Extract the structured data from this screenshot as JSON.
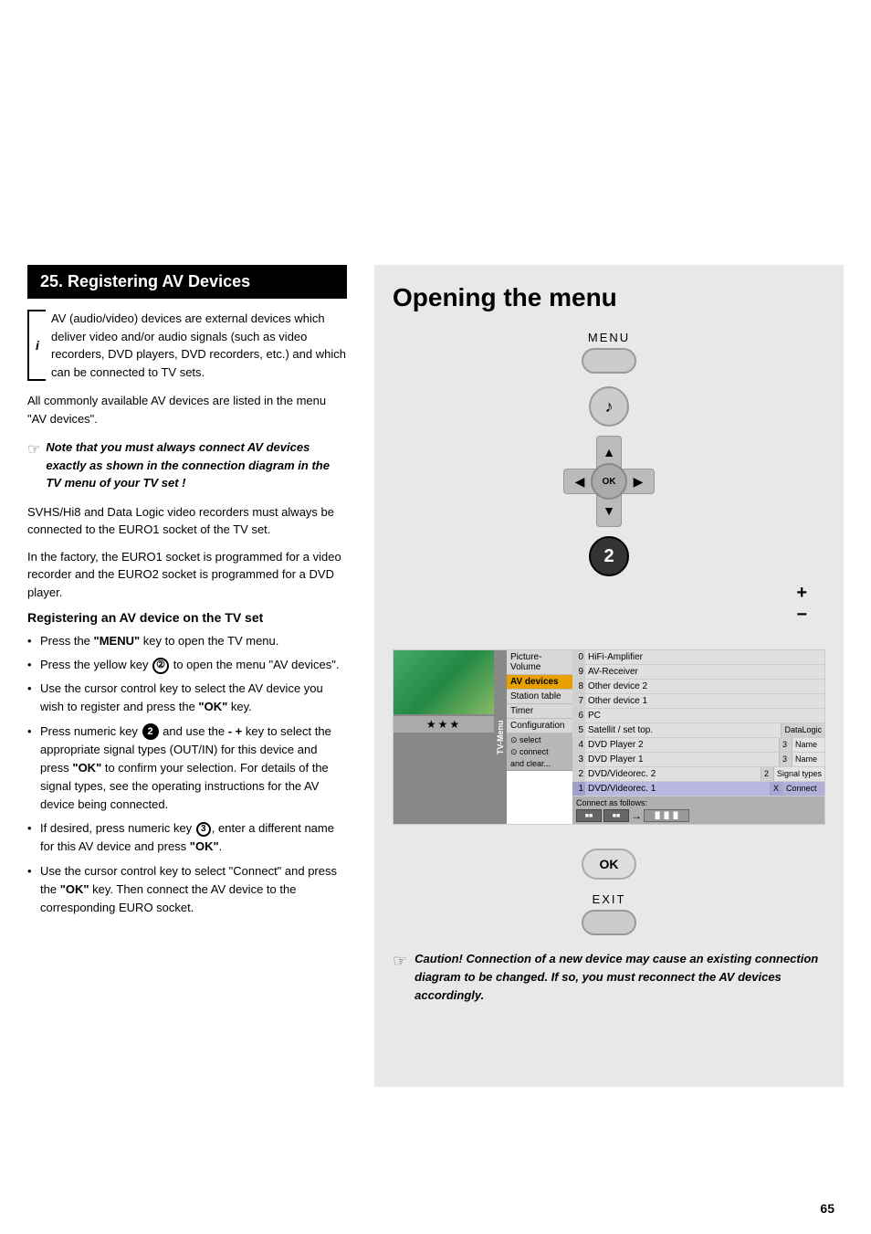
{
  "page": {
    "number": "65",
    "top_space_height": 290
  },
  "left_column": {
    "section_title": "25. Registering AV Devices",
    "info_marker_letter": "i",
    "info_paragraph": "AV (audio/video) devices are external devices which deliver video and/or audio signals (such as video recorders, DVD players, DVD recorders, etc.) and which can be connected to TV sets.",
    "all_devices_text": "All commonly available AV devices are listed in the menu \"AV devices\".",
    "note_icon": "☞",
    "note_text": "Note that you must always connect AV devices exactly as shown in the connection diagram in the TV menu of your TV set !",
    "body_text_1": "SVHS/Hi8 and Data Logic video recorders must always be connected to the EURO1 socket of the TV set.",
    "body_text_2": "In the factory, the EURO1 socket is programmed for a video recorder and the EURO2 socket is programmed for a DVD player.",
    "sub_heading": "Registering an AV device on the TV set",
    "bullets": [
      "Press the \"MENU\" key to open the TV menu.",
      "Press the yellow key ② to open the menu \"AV devices\".",
      "Use the cursor control key to select the AV device you wish to register and press the \"OK\" key.",
      "Press numeric key ② and use the - + key to select the appropriate signal types (OUT/IN) for this device and press \"OK\" to confirm your selection. For details of the signal types, see the operating instructions for the AV device being connected.",
      "If desired, press numeric key ③, enter a different name for this AV device and press \"OK\".",
      "Use the cursor control key to select \"Connect\" and press the \"OK\" key. Then connect the AV device to the corresponding EURO socket."
    ],
    "sub_heading_anchor": "Registering an AV device"
  },
  "right_column": {
    "title": "Opening the menu",
    "menu_label": "MENU",
    "music_icon": "♪",
    "dpad": {
      "ok_label": "OK",
      "up": "△",
      "down": "▽",
      "left": "◁",
      "right": "▷"
    },
    "num2": "2",
    "plus_label": "+",
    "minus_label": "−",
    "tv_menu": {
      "channels": [
        {
          "num": "0",
          "name": "HiFi-Amplifier",
          "highlighted": false
        },
        {
          "num": "9",
          "name": "AV-Receiver",
          "highlighted": false
        },
        {
          "num": "8",
          "name": "Other device 2",
          "highlighted": false
        },
        {
          "num": "7",
          "name": "Other device 1",
          "highlighted": false
        },
        {
          "num": "6",
          "name": "PC",
          "highlighted": false
        },
        {
          "num": "5",
          "name": "Satellit / set top.",
          "highlighted": false,
          "extra1": "DataLogic",
          "extra2": ""
        },
        {
          "num": "4",
          "name": "DVD Player 2",
          "highlighted": false,
          "extra1": "3",
          "extra2": "Name"
        },
        {
          "num": "3",
          "name": "DVD Player 1",
          "highlighted": false,
          "extra1": "3",
          "extra2": "Name"
        },
        {
          "num": "2",
          "name": "DVD/Videorec. 2",
          "highlighted": false,
          "extra1": "2",
          "extra2": "Signal types"
        },
        {
          "num": "1",
          "name": "DVD/Videorec. 1",
          "highlighted": true,
          "extra1": "X",
          "extra2": "Connect"
        }
      ],
      "sidebar_items": [
        "Picture-Volume",
        "AV devices",
        "Station table",
        "Timer",
        "Configuration"
      ],
      "active_item": "AV devices",
      "connect_label": "Connect as follows:",
      "select_label": "select",
      "connect_action": "connect",
      "clear_label": "and clear..."
    },
    "ok_btn_label": "OK",
    "exit_label": "EXIT",
    "caution_icon": "☞",
    "caution_text": "Caution! Connection of a new device may cause an existing connection diagram to be changed. If so, you must reconnect the AV devices accordingly."
  }
}
